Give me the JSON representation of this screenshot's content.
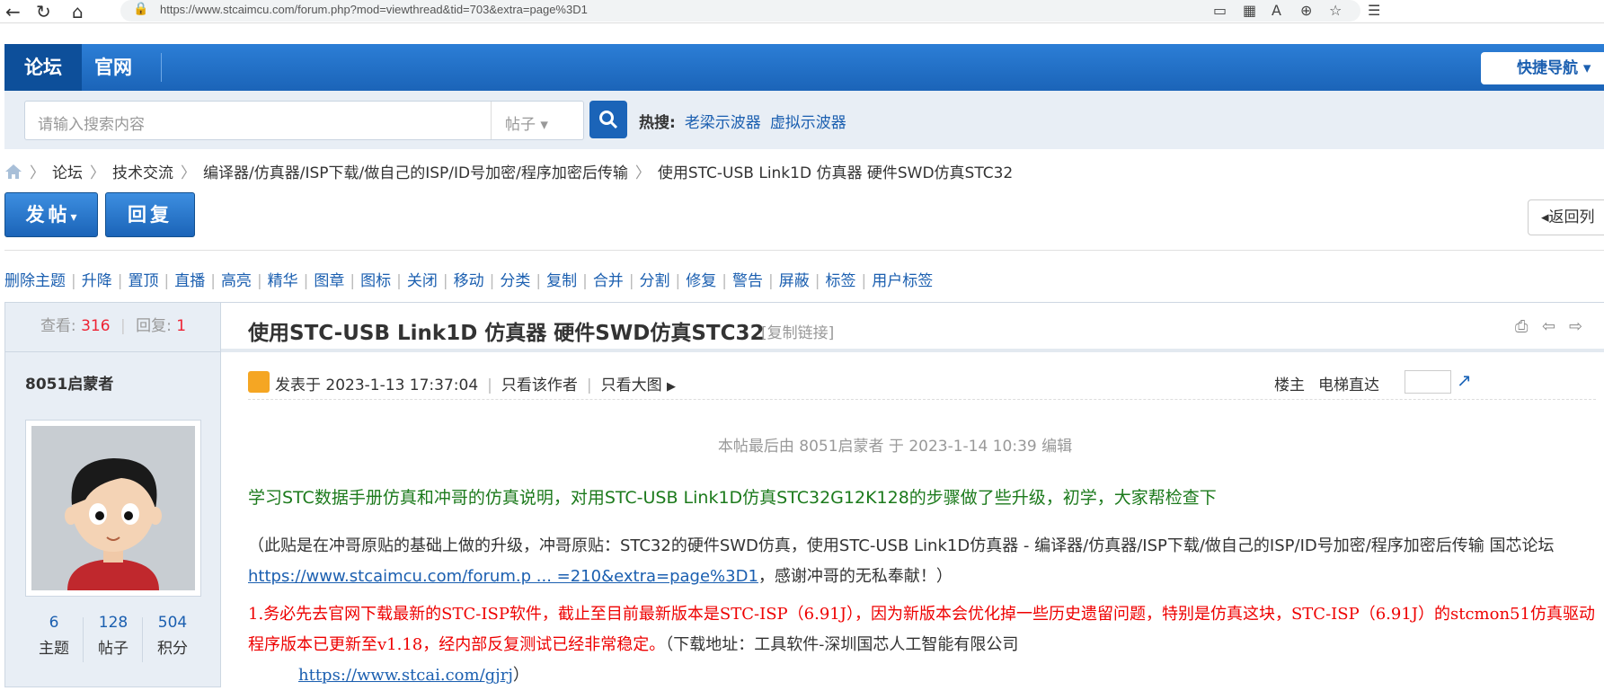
{
  "browser": {
    "url": "https://www.stcaimcu.com/forum.php?mod=viewthread&tid=703&extra=page%3D1",
    "back": "←",
    "reload": "↻",
    "home": "⌂",
    "lock": "🔒"
  },
  "topnav": {
    "tab_forum": "论坛",
    "tab_official": "官网",
    "quick_nav": "快捷导航"
  },
  "search": {
    "placeholder": "请输入搜索内容",
    "type": "帖子",
    "hot_label": "热搜:",
    "hot_items": [
      "老梁示波器",
      "虚拟示波器"
    ]
  },
  "breadcrumb": {
    "items": [
      "论坛",
      "技术交流",
      "编译器/仿真器/ISP下载/做自己的ISP/ID号加密/程序加密后传输",
      "使用STC-USB Link1D 仿真器 硬件SWD仿真STC32"
    ]
  },
  "actions": {
    "post": "发帖",
    "reply": "回复",
    "back_list": "返回列"
  },
  "admin_links": [
    "删除主题",
    "升降",
    "置顶",
    "直播",
    "高亮",
    "精华",
    "图章",
    "图标",
    "关闭",
    "移动",
    "分类",
    "复制",
    "合并",
    "分割",
    "修复",
    "警告",
    "屏蔽",
    "标签",
    "用户标签"
  ],
  "stats": {
    "views_label": "查看:",
    "views": "316",
    "replies_label": "回复:",
    "replies": "1"
  },
  "author": {
    "name": "8051启蒙者",
    "topics": "6",
    "topics_label": "主题",
    "posts": "128",
    "posts_label": "帖子",
    "credits": "504",
    "credits_label": "积分"
  },
  "thread": {
    "title": "使用STC-USB Link1D 仿真器 硬件SWD仿真STC32",
    "copy_link": "[复制链接]",
    "posted_at": "发表于 2023-1-13 17:37:04",
    "only_author": "只看该作者",
    "only_images": "只看大图",
    "floor": "楼主",
    "elevator": "电梯直达",
    "edit_note": "本帖最后由 8051启蒙者 于 2023-1-14 10:39 编辑",
    "intro": "学习STC数据手册仿真和冲哥的仿真说明，对用STC-USB Link1D仿真STC32G12K128的步骤做了些升级，初学，大家帮检查下",
    "para1_a": "（此贴是在冲哥原贴的基础上做的升级，冲哥原贴：STC32的硬件SWD仿真，使用STC-USB Link1D仿真器 - 编译器/仿真器/ISP下载/做自己的ISP/ID号加密/程序加密后传输 国芯论坛 ",
    "para1_link": "https://www.stcaimcu.com/forum.p ... =210&extra=page%3D1",
    "para1_b": "，感谢冲哥的无私奉献！）",
    "para2_num": "1.",
    "para2_red": "务必先去官网下载最新的STC-ISP软件，截止至目前最新版本是STC-ISP（6.91J），因为新版本会优化掉一些历史遗留问题，特别是仿真这块，STC-ISP（6.91J）的stcmon51仿真驱动程序版本已更新至v1.18，经内部反复测试已经非常稳定。",
    "para2_tail": "（下载地址：工具软件-深圳国芯人工智能有限公司",
    "para2_link": "https://www.stcai.com/gjrj",
    "para2_end": "）"
  }
}
